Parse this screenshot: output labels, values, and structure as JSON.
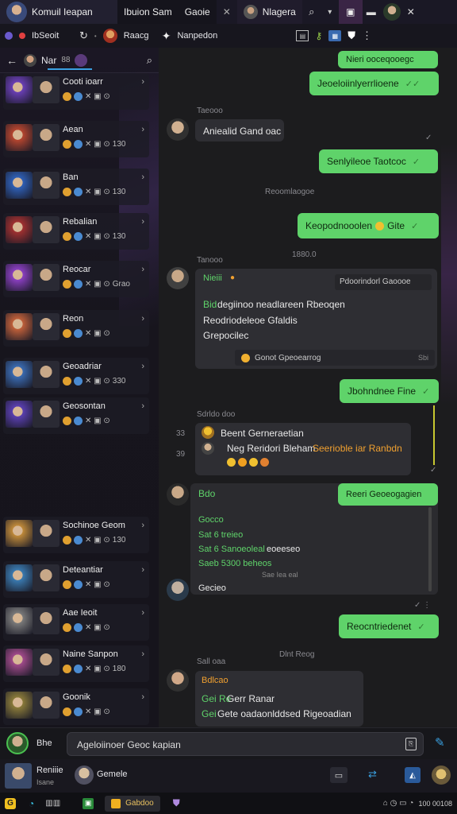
{
  "topbar": {
    "app_title": "Komuil Ieapan",
    "tab1": "Ibuion Sam",
    "tab2": "Gaoie",
    "tab3": "Nlagera"
  },
  "toolbar": {
    "account": "IbSeoit",
    "item1": "Raacg",
    "item2": "Nanpedon"
  },
  "sidebar": {
    "header_title": "Nar",
    "header_badge": "88",
    "chats": [
      {
        "name": "Cooti ioarr",
        "meta": "",
        "accent": "#6a3fb5"
      },
      {
        "name": "Aean",
        "meta": "130",
        "accent": "#b5452f"
      },
      {
        "name": "Ban",
        "meta": "130",
        "accent": "#2f5fb5"
      },
      {
        "name": "Rebalian",
        "meta": "130",
        "accent": "#a03030"
      },
      {
        "name": "Reocar",
        "meta": "Grao",
        "accent": "#8a3fc0"
      },
      {
        "name": "Reon",
        "meta": "",
        "accent": "#c0603a"
      },
      {
        "name": "Geoadriar",
        "meta": "330",
        "accent": "#3a6ab0"
      },
      {
        "name": "Geosontan",
        "meta": "",
        "accent": "#5a3fb0"
      },
      {
        "name": "Sochinoe Geom",
        "meta": "130",
        "accent": "#c08a3a"
      },
      {
        "name": "Deteantiar",
        "meta": "",
        "accent": "#3a7ab0"
      },
      {
        "name": "Aae Ieoit",
        "meta": "",
        "accent": "#7a7a7a"
      },
      {
        "name": "Naine Sanpon",
        "meta": "180",
        "accent": "#a04a8a"
      },
      {
        "name": "Goonik",
        "meta": "",
        "accent": "#8a7a3a"
      }
    ]
  },
  "messages": {
    "m0": "Nieri ooceqooegc",
    "m1": "Jeoeloiinlyerrlioene",
    "ts1": "Taeooo",
    "m2": "Aniealid Gand oac",
    "m3": "Senlyileoe Taotcoc",
    "ts2": "Reoomlaogoe",
    "m4": "Keopodnooolen",
    "m4b": "Gite",
    "ts3": "1880.0",
    "ts4": "Tanooo",
    "card1_head": "Nieiii",
    "card1_side": "Pdoorindorl Gaoooe",
    "card1_line1": "degiinoo neadlareen Rbeoqen",
    "card1_line1_prefix": "Bid",
    "card1_line2": "Reodriodeleoe Gfaldis",
    "card1_line3": "Grepocilec",
    "card1_foot": "Gonot Gpeoearrog",
    "card1_foot_ts": "Sbi",
    "m5": "Jbohndnee Fine",
    "ts5": "Sdrldo doo",
    "card2_title": "Beent Gerneraetian",
    "card2_line": "Neg Reridori Bleham",
    "card2_line_orange": "Seerioble iar Ranbdn",
    "card2_num1": "33",
    "card2_num2": "39",
    "m6": "Reeri Geoeogagien",
    "card3_head": "Bdo",
    "card3_l1": "Gocco",
    "card3_l2": "Sat 6 treieo",
    "card3_l3": "Sat 6 Sanoeoleal",
    "card3_l3b": "eoeeseo",
    "card3_l4": "Saeb 5300 beheos",
    "card3_ts": "Sae Iea eal",
    "card3_l5": "Gecieo",
    "m7": "Reocntriedenet",
    "ts6": "Dlnt Reog",
    "ts7": "Sall oaa",
    "card4_head": "Bdlcao",
    "card4_l1": "Gerr Ranar",
    "card4_l1p": "Gei Re",
    "card4_l2": "Gete oadaonlddsed Rigeoadian",
    "card4_l2p": "Gei"
  },
  "compose": {
    "user_label": "Bhe",
    "placeholder": "Ageloiinoer Geoc kapian"
  },
  "bottom": {
    "name1": "Reniiie",
    "name1b": "Isane",
    "name2": "Gemele"
  },
  "taskbar": {
    "item1": "G",
    "item2": "Gabdoo",
    "ts": "100 00108"
  },
  "colors": {
    "bubble_out": "#5fd36a",
    "bubble_in": "#2e2e33",
    "accent_green": "#5fd36a",
    "accent_orange": "#f0a030",
    "app_bg": "#1c1c1e"
  }
}
